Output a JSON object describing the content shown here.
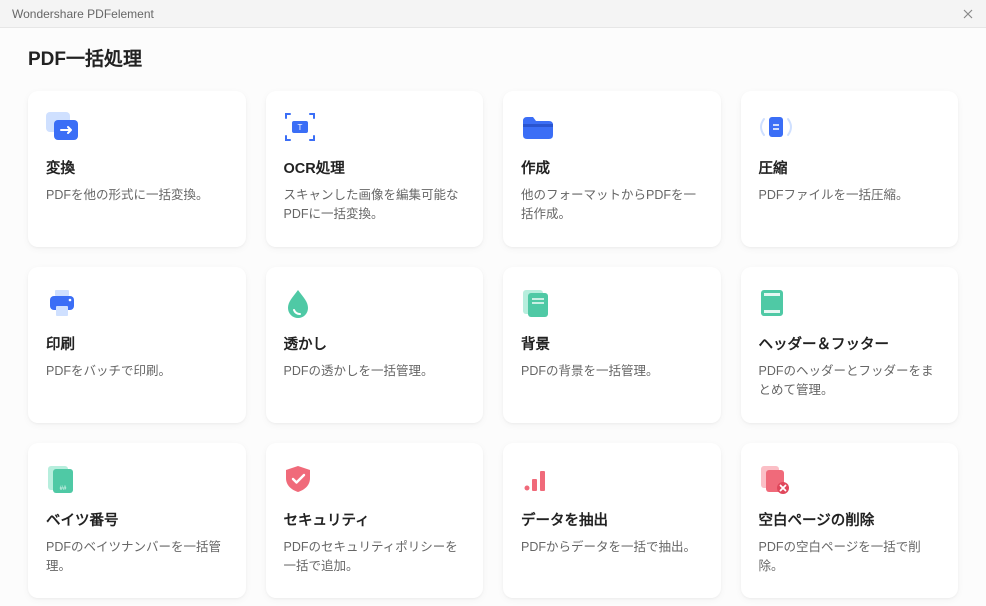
{
  "window": {
    "title": "Wondershare PDFelement"
  },
  "page": {
    "title": "PDF一括処理"
  },
  "cards": [
    {
      "title": "変換",
      "desc": "PDFを他の形式に一括変換。"
    },
    {
      "title": "OCR処理",
      "desc": "スキャンした画像を編集可能なPDFに一括変換。"
    },
    {
      "title": "作成",
      "desc": "他のフォーマットからPDFを一括作成。"
    },
    {
      "title": "圧縮",
      "desc": "PDFファイルを一括圧縮。"
    },
    {
      "title": "印刷",
      "desc": "PDFをバッチで印刷。"
    },
    {
      "title": "透かし",
      "desc": "PDFの透かしを一括管理。"
    },
    {
      "title": "背景",
      "desc": "PDFの背景を一括管理。"
    },
    {
      "title": "ヘッダー＆フッター",
      "desc": "PDFのヘッダーとフッダーをまとめて管理。"
    },
    {
      "title": "ベイツ番号",
      "desc": "PDFのベイツナンバーを一括管理。"
    },
    {
      "title": "セキュリティ",
      "desc": "PDFのセキュリティポリシーを一括で追加。"
    },
    {
      "title": "データを抽出",
      "desc": "PDFからデータを一括で抽出。"
    },
    {
      "title": "空白ページの削除",
      "desc": "PDFの空白ページを一括で削除。"
    }
  ]
}
